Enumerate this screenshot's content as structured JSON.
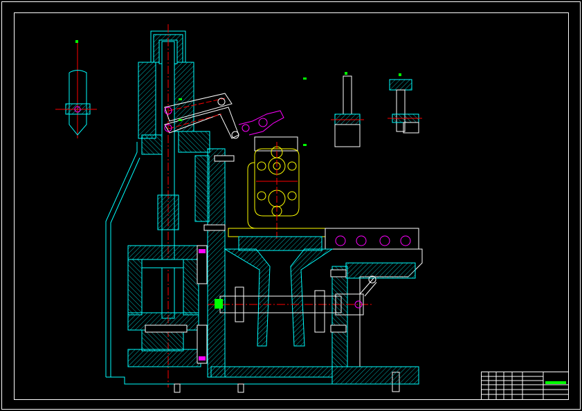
{
  "drawing": {
    "title_block_label": "",
    "colors": {
      "background": "#000000",
      "frame": "#ffffff",
      "cyan_part": "#00ffff",
      "hatch": "#00c8c8",
      "center_line": "#ff0000",
      "yellow_part": "#ffff00",
      "magenta_part": "#ff00ff",
      "green_dim": "#00ff00",
      "bolt": "#ffffff"
    },
    "icons": [
      "technical-drawing",
      "section-view",
      "title-block"
    ]
  }
}
